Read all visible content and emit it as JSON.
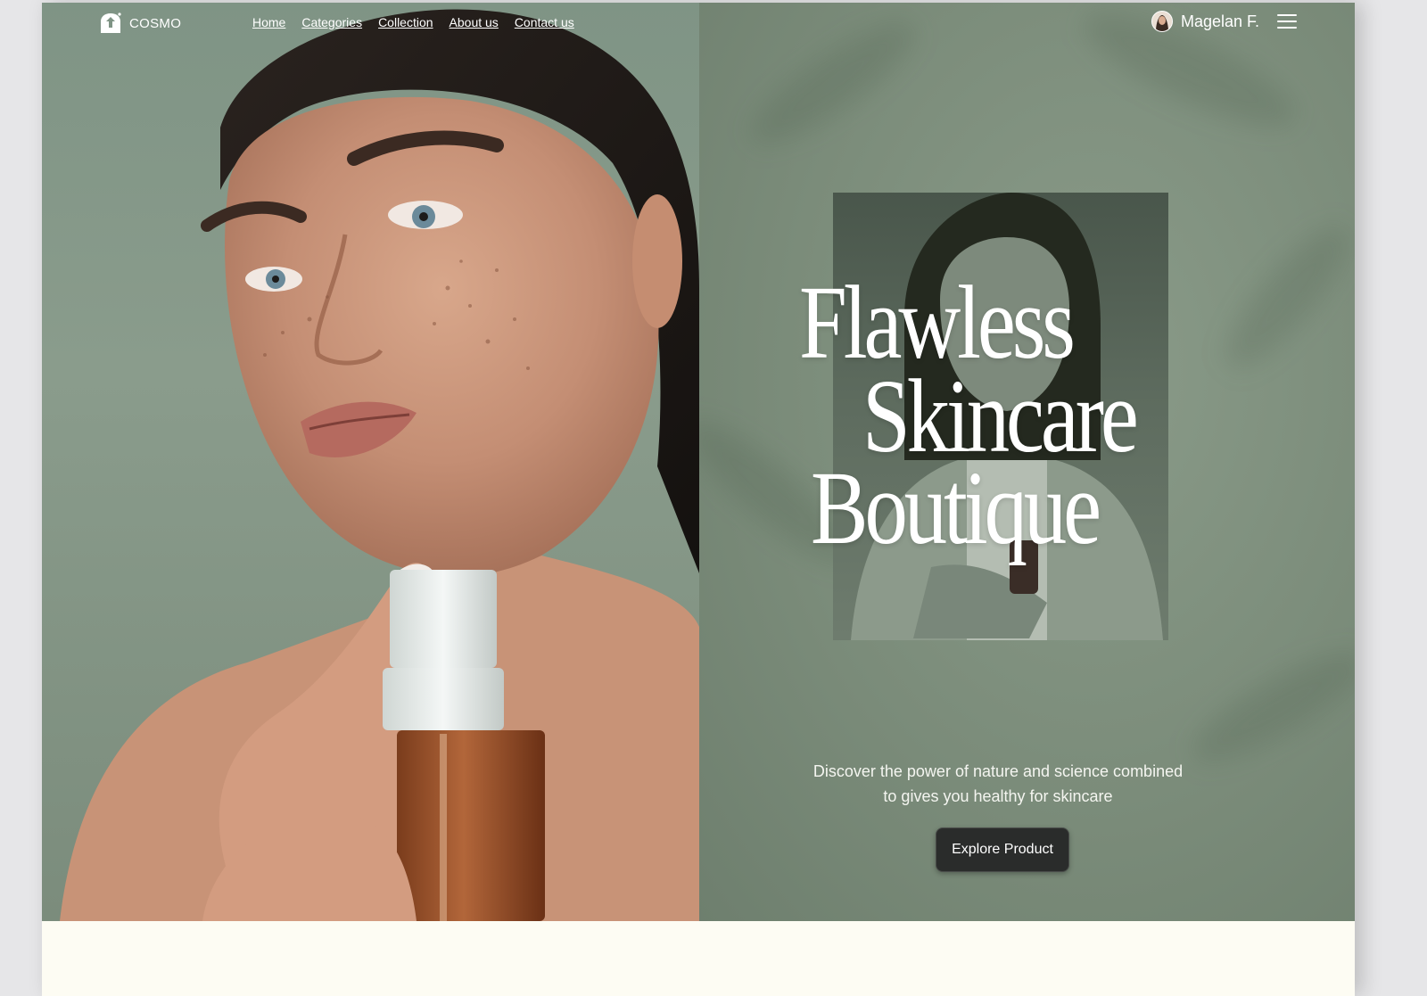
{
  "brand": {
    "name": "COSMO",
    "logo_icon": "house-leaf-icon"
  },
  "nav": {
    "links": [
      "Home",
      "Categories",
      "Collection",
      "About us",
      "Contact us"
    ]
  },
  "user": {
    "name": "Magelan F.",
    "avatar_icon": "user-avatar",
    "menu_icon": "hamburger-menu-icon"
  },
  "hero": {
    "headline_line1": "Flawless",
    "headline_line2": "Skincare",
    "headline_line3": "Boutique",
    "tagline_line1": "Discover the power of nature and science combined",
    "tagline_line2": "to gives you healthy for skincare",
    "cta_label": "Explore Product"
  },
  "colors": {
    "sage_background": "#7b8c7a",
    "button_dark": "#2a2c2b",
    "cream_footer": "#fdfcf3"
  }
}
